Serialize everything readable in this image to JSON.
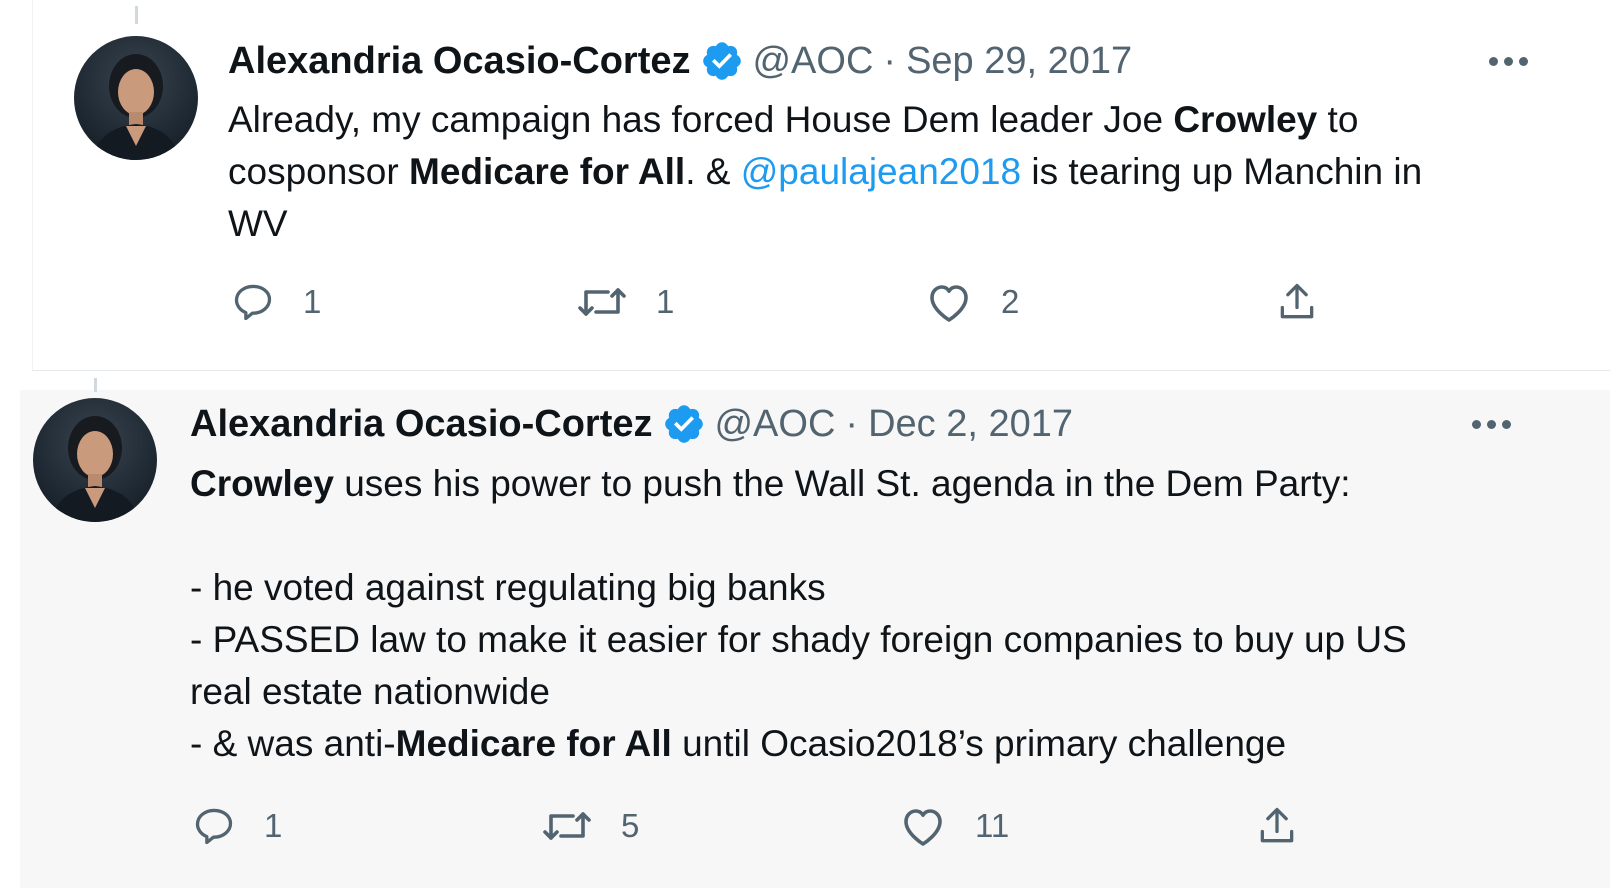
{
  "tweets": [
    {
      "display_name": "Alexandria Ocasio-Cortez",
      "handle": "@AOC",
      "separator": "·",
      "date": "Sep 29, 2017",
      "text": {
        "p1": "Already, my campaign has forced House Dem leader Joe ",
        "b1": "Crowley",
        "p2": " to\ncosponsor ",
        "b2": "Medicare for All",
        "p3": ". & ",
        "mention": "@paulajean2018",
        "p4": " is tearing up Manchin in\nWV"
      },
      "counts": {
        "replies": "1",
        "retweets": "1",
        "likes": "2"
      }
    },
    {
      "display_name": "Alexandria Ocasio-Cortez",
      "handle": "@AOC",
      "separator": "·",
      "date": "Dec 2, 2017",
      "text": {
        "b1": "Crowley",
        "p1": " uses his power to push the Wall St. agenda in the Dem Party:\n\n- he voted against regulating big banks\n- PASSED law to make it easier for shady foreign companies to buy up US\nreal estate nationwide\n- & was anti-",
        "b2": "Medicare for All",
        "p2": " until Ocasio2018’s primary challenge"
      },
      "counts": {
        "replies": "1",
        "retweets": "5",
        "likes": "11"
      }
    }
  ],
  "icons": {
    "verified": "verified-badge-icon",
    "more": "more-horizontal-icon",
    "reply": "reply-icon",
    "retweet": "retweet-icon",
    "like": "heart-icon",
    "share": "share-icon"
  },
  "colors": {
    "accent": "#1d9bf0",
    "text": "#0f1419",
    "secondary": "#536471"
  }
}
